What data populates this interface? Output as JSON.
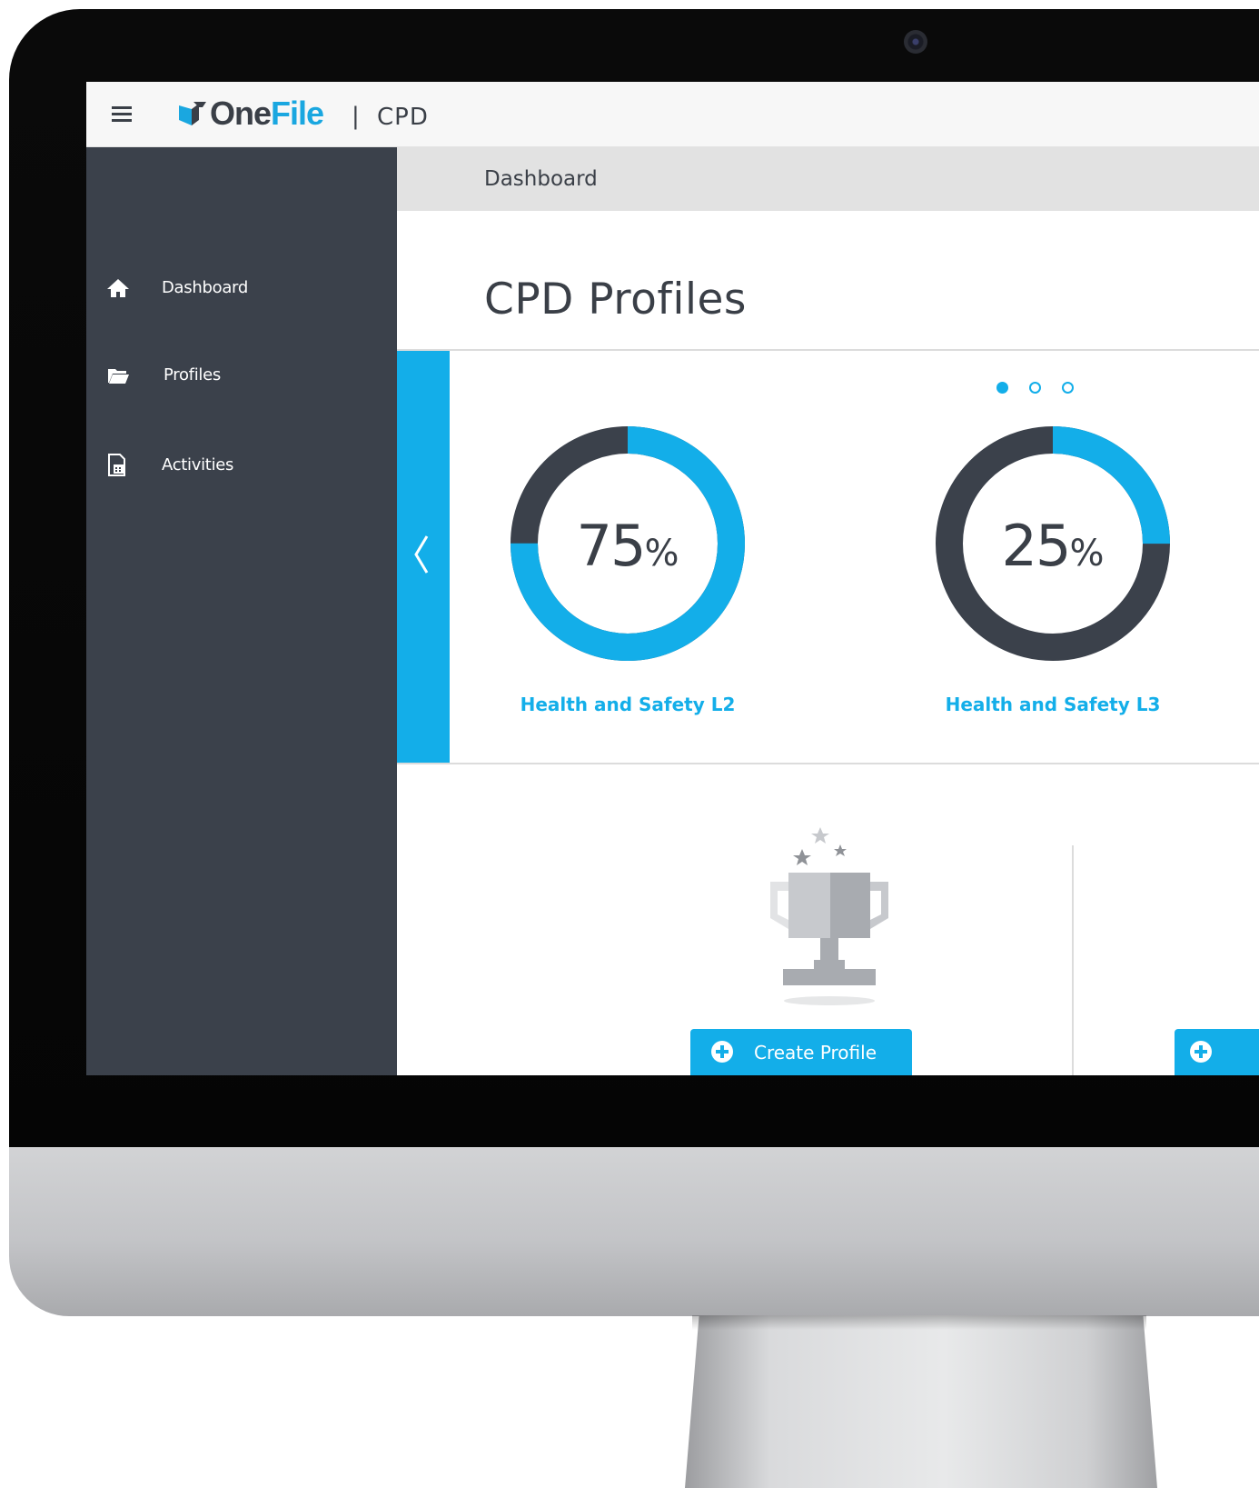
{
  "app": {
    "logo_text_one": "One",
    "logo_text_file": "File",
    "separator": "|",
    "name": "CPD"
  },
  "sidebar": {
    "items": [
      {
        "label": "Dashboard",
        "icon": "home-icon"
      },
      {
        "label": "Profiles",
        "icon": "folder-open-icon"
      },
      {
        "label": "Activities",
        "icon": "calendar-document-icon"
      }
    ]
  },
  "breadcrumb": "Dashboard",
  "page_title": "CPD Profiles",
  "carousel": {
    "active_page": 1,
    "page_count": 3,
    "profiles": [
      {
        "name": "Health and Safety L2",
        "percent": 75,
        "percent_sign": "%"
      },
      {
        "name": "Health and Safety L3",
        "percent": 25,
        "percent_sign": "%"
      }
    ]
  },
  "actions": {
    "create_profile_label": "Create Profile"
  },
  "colors": {
    "accent": "#13aee9",
    "sidebar": "#3b414b",
    "text_dark": "#3a3f47"
  }
}
